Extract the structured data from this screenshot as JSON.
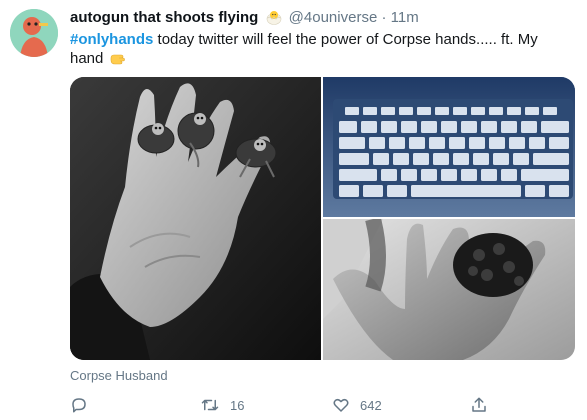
{
  "tweet": {
    "display_name": "autogun that shoots flying",
    "emoji_chick": "hatching-chick-emoji",
    "handle": "@4ouniverse",
    "separator": "·",
    "time": "11m",
    "hashtag": "#onlyhands",
    "text": " today twitter will feel the power of Corpse hands..... ft. My hand",
    "emoji_hand": "hand-emoji",
    "media_caption": "Corpse Husband",
    "reply_count": "",
    "retweet_count": "16",
    "like_count": "642"
  },
  "colors": {
    "accent": "#1b95e0",
    "muted": "#657786",
    "text": "#14171a"
  },
  "icons": {
    "reply": "reply-icon",
    "retweet": "retweet-icon",
    "like": "heart-icon",
    "share": "share-icon"
  }
}
